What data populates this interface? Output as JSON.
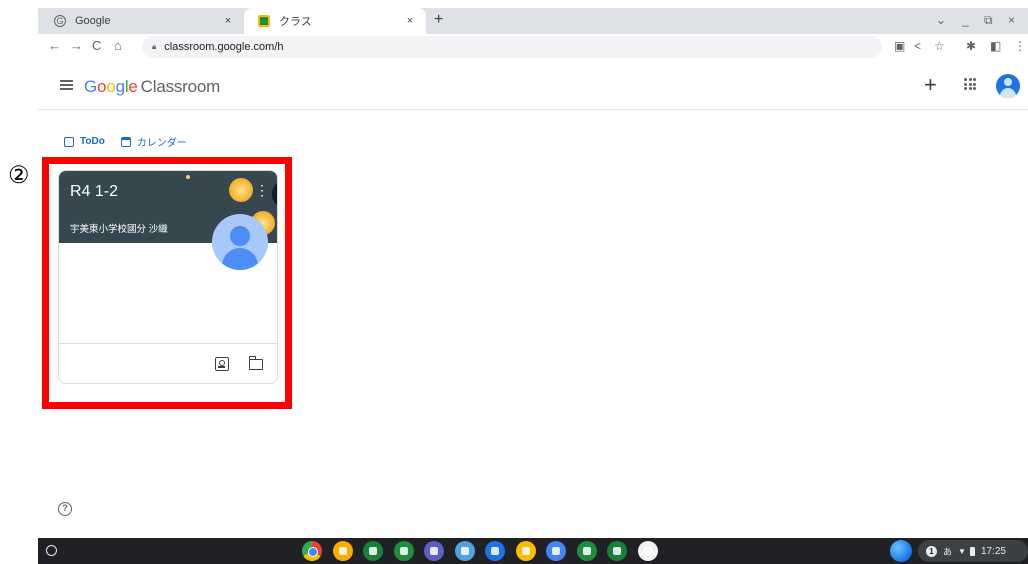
{
  "browser": {
    "tabs": [
      {
        "title": "Google",
        "active": false
      },
      {
        "title": "クラス",
        "active": true
      }
    ],
    "close_glyph": "×",
    "new_tab_glyph": "+",
    "url": "classroom.google.com/h",
    "window_controls": [
      "⌄",
      "_",
      "⧉",
      "×"
    ],
    "nav_glyphs": {
      "back": "←",
      "forward": "→",
      "reload": "C",
      "home": "⌂"
    },
    "toolbar_icons": [
      "translate-icon",
      "share-icon",
      "bookmark-star-icon",
      "extensions-icon",
      "side-panel-icon",
      "menu-icon"
    ],
    "toolbar_glyphs": {
      "translate": "▣",
      "share": "<",
      "star": "☆",
      "extensions": "✱",
      "sidepanel": "◧",
      "menu": "⋮"
    }
  },
  "app": {
    "logo_letters": [
      "G",
      "o",
      "o",
      "g",
      "l",
      "e"
    ],
    "product": "Classroom",
    "create_glyph": "+"
  },
  "subnav": {
    "todo": "ToDo",
    "calendar": "カレンダー"
  },
  "annotation": {
    "marker": "②",
    "highlight_color": "#ff0000"
  },
  "class_card": {
    "title": "R4 1-2",
    "owner": "宇美東小学校國分 沙織",
    "banner_color": "#37474f",
    "menu_glyph": "⋮"
  },
  "help": {
    "glyph": "?"
  },
  "shelf": {
    "apps": [
      {
        "name": "chrome",
        "color": "#4285f4"
      },
      {
        "name": "app-orange",
        "color": "#f9ab00"
      },
      {
        "name": "app-green-text",
        "color": "#188038"
      },
      {
        "name": "app-green-music",
        "color": "#1e8e3e"
      },
      {
        "name": "teams",
        "color": "#5b5fc7"
      },
      {
        "name": "app-character",
        "color": "#4fa3e0"
      },
      {
        "name": "meet",
        "color": "#1a73e8"
      },
      {
        "name": "slides",
        "color": "#fbbc04"
      },
      {
        "name": "docs",
        "color": "#4285f4"
      },
      {
        "name": "sheets",
        "color": "#1e8e3e"
      },
      {
        "name": "classroom",
        "color": "#188038"
      },
      {
        "name": "app-grid",
        "color": "#f1f3f4"
      }
    ],
    "tray": {
      "notification_count": "1",
      "ime": "あ",
      "wifi_glyph": "▼",
      "time": "17:25"
    }
  }
}
